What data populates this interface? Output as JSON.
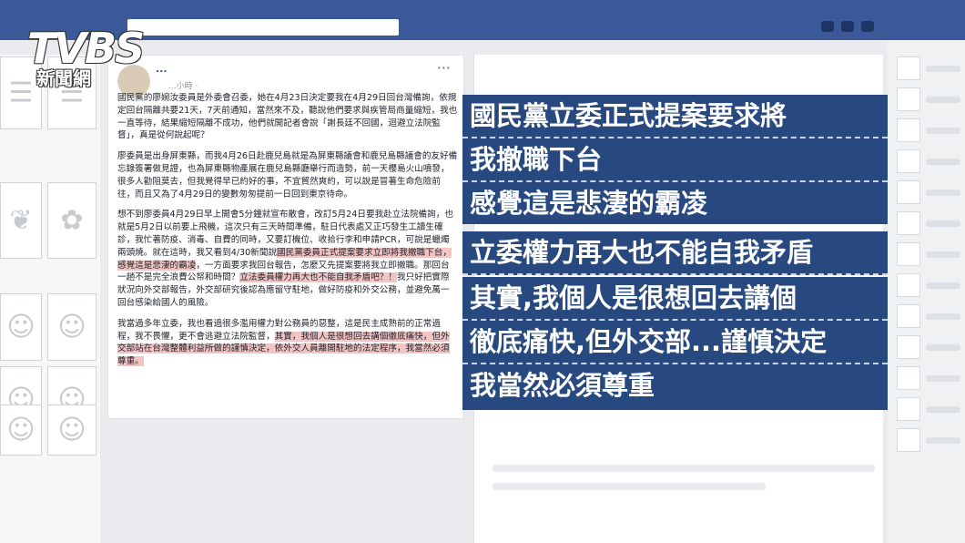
{
  "logo": {
    "main": "TVBS",
    "sub": "新聞網"
  },
  "post": {
    "author": "...",
    "meta": "...小時 · ",
    "more": "···",
    "paragraphs": [
      {
        "plain": "國民黨的廖婉汝委員是外委會召委，她在4月23日決定要我在4月29日回台灣備詢，依規定回台隔離共要21天，7天前通知，當然來不及，聽說他們要求與疾管局商量縮短，我也一直等待，結果縮短隔離不成功，他們就開記者會說「謝長廷不回國，迴避立法院監督」，真是從何說起呢？"
      },
      {
        "plain": "廖委員是出身屏東縣，而我4月26日赴鹿兒島就是為屏東縣議會和鹿兒島縣議會的友好備忘錄簽署做見證，也為屏東縣物產展在鹿兒島縣廳舉行而造勢，前一天櫻島火山噴發，很多人勸阻莫去，但我覺得早已約好的事，不宜貿然爽約，可以說是冒著生命危險前往，而且又為了4月29日的變數匆匆提前一日回到東京待命。"
      },
      {
        "pre": "想不到廖委員4月29日早上開會5分鐘就宣布散會，改訂5月24日要我赴立法院備詢，也就是5月2日以前要上飛機，這次只有三天時間準備，駐日代表處又正巧發生工讀生確診，我忙著防疫、消毒、自費的同時，又要訂機位、收拾行李和申請PCR，可說是蠟燭兩頭燒。就在這時，我又看到4/30新聞說",
        "hl1": "國民黨委員正式提案要求立即將我撤職下台，感覺這是悲淒的霸凌",
        "mid": "，一方面要求我回台報告，怎麼又先提案要將我立即撤職。那回台一趟不是完全浪費公帑和時間？",
        "hl2": "立法委員權力再大也不能自我矛盾吧？！",
        "post": "我只好把實際狀況向外交部報告，外交部研究後認為應留守駐地，做好防疫和外交公務，並避免萬一回台感染給國人的風險。"
      },
      {
        "pre": "我當過多年立委，我也看過很多濫用權力對公務員的惡整，這是民主成熟前的正常過程，我不畏懼，更不會逃避立法院監督，",
        "hl1": "其實，我個人是很想回去講個徹底痛快，但外交部站在台灣整體利益所做的謹慎決定，依外交人員離開駐地的法定程序，我當然必須尊重。"
      }
    ]
  },
  "captions": [
    "國民黨立委正式提案要求將",
    "我撤職下台",
    "感覺這是悲淒的霸凌",
    "立委權力再大也不能自我矛盾",
    "其實,我個人是很想回去講個",
    "徹底痛快,但外交部...謹慎決定",
    "我當然必須尊重"
  ],
  "colors": {
    "header": "#3b5998",
    "caption_bg": "#27497f",
    "highlight": "#f3c4c4"
  }
}
